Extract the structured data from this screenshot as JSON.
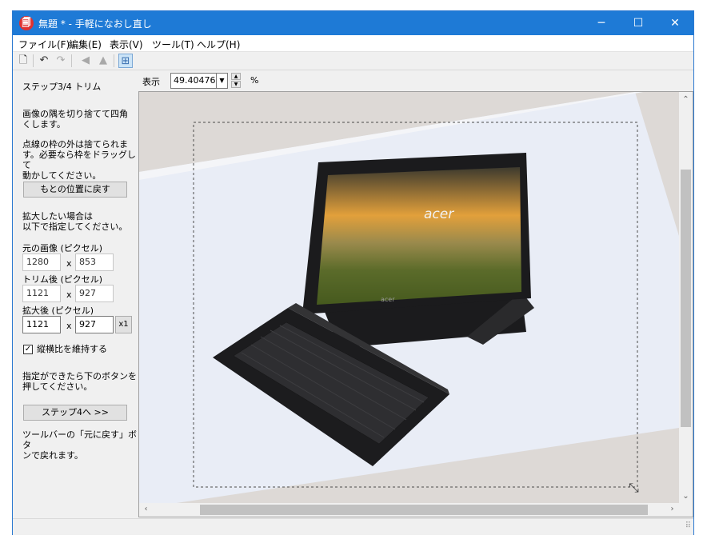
{
  "window": {
    "title": "無題 * - 手軽になおし直し",
    "app_icon": "🗐",
    "controls": {
      "minimize": "─",
      "maximize": "☐",
      "close": "✕"
    }
  },
  "menu": [
    "ファイル(F)",
    "編集(E)",
    "表示(V)",
    "ツール(T)",
    "ヘルプ(H)"
  ],
  "toolbar": {
    "icons": [
      "new-document-icon",
      "undo-icon",
      "redo-icon",
      "flip-horizontal-icon",
      "flip-vertical-icon",
      "grid-icon"
    ]
  },
  "sidebar": {
    "step_title": "ステップ3/4  トリム",
    "description": "画像の隅を切り捨てて四角\nくします。",
    "instruction": "点線の枠の外は捨てられま\nす。必要なら枠をドラッグして\n動かしてください。",
    "reset_button": "もとの位置に戻す",
    "enlarge_hint": "拡大したい場合は\n以下で指定してください。",
    "original_label": "元の画像 (ピクセル)",
    "original_w": "1280",
    "original_h": "853",
    "trimmed_label": "トリム後 (ピクセル)",
    "trimmed_w": "1121",
    "trimmed_h": "927",
    "enlarged_label": "拡大後 (ピクセル)",
    "enlarged_w": "1121",
    "enlarged_h": "927",
    "times_sign": "x",
    "scale_button": "x1",
    "keep_ratio_label": "縦横比を維持する",
    "keep_ratio_checked": true,
    "next_hint": "指定ができたら下のボタンを\n押してください。",
    "next_button": "ステップ4へ >>",
    "footer_hint": "ツールバーの「元に戻す」ボタ\nンで戻れます。"
  },
  "zoom": {
    "label": "表示",
    "value": "49.40476",
    "unit": "%"
  },
  "canvas": {
    "laptop_brand": "acer",
    "colors": {
      "background_gray": "#ddd9d6",
      "photo_bg": "#e9edf6",
      "device": "#1b1b1d"
    }
  }
}
